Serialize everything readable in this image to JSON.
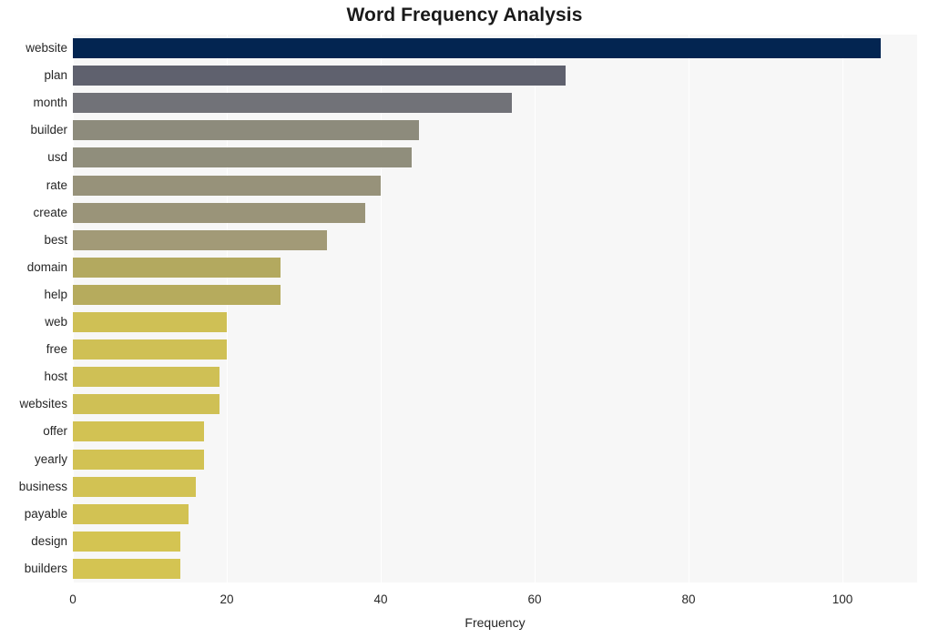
{
  "chart_data": {
    "type": "bar",
    "orientation": "horizontal",
    "title": "Word Frequency Analysis",
    "xlabel": "Frequency",
    "ylabel": "",
    "xlim": [
      0,
      109.7
    ],
    "xticks": [
      "0",
      "20",
      "40",
      "60",
      "80",
      "100"
    ],
    "xtick_values": [
      0,
      20,
      40,
      60,
      80,
      100
    ],
    "grid": "vertical-only",
    "legend": "none",
    "categories": [
      "website",
      "plan",
      "month",
      "builder",
      "usd",
      "rate",
      "create",
      "best",
      "domain",
      "help",
      "web",
      "free",
      "host",
      "websites",
      "offer",
      "yearly",
      "business",
      "payable",
      "design",
      "builders"
    ],
    "values": [
      105,
      64,
      57,
      45,
      44,
      40,
      38,
      33,
      27,
      27,
      20,
      20,
      19,
      19,
      17,
      17,
      16,
      15,
      14,
      14
    ],
    "bar_colors": [
      "#032551",
      "#5f616e",
      "#717278",
      "#8d8b7c",
      "#908e7c",
      "#97927a",
      "#9a9479",
      "#a29a77",
      "#b3a95f",
      "#b6ab5d",
      "#cfc055",
      "#cfc055",
      "#cfc055",
      "#cfc055",
      "#d2c253",
      "#d2c253",
      "#d2c253",
      "#d2c253",
      "#d4c452",
      "#d4c452"
    ],
    "plot_background": "#f7f7f7",
    "gridline_color": "#ffffff",
    "title_color": "#1a1a1a",
    "text_color": "#262626"
  }
}
